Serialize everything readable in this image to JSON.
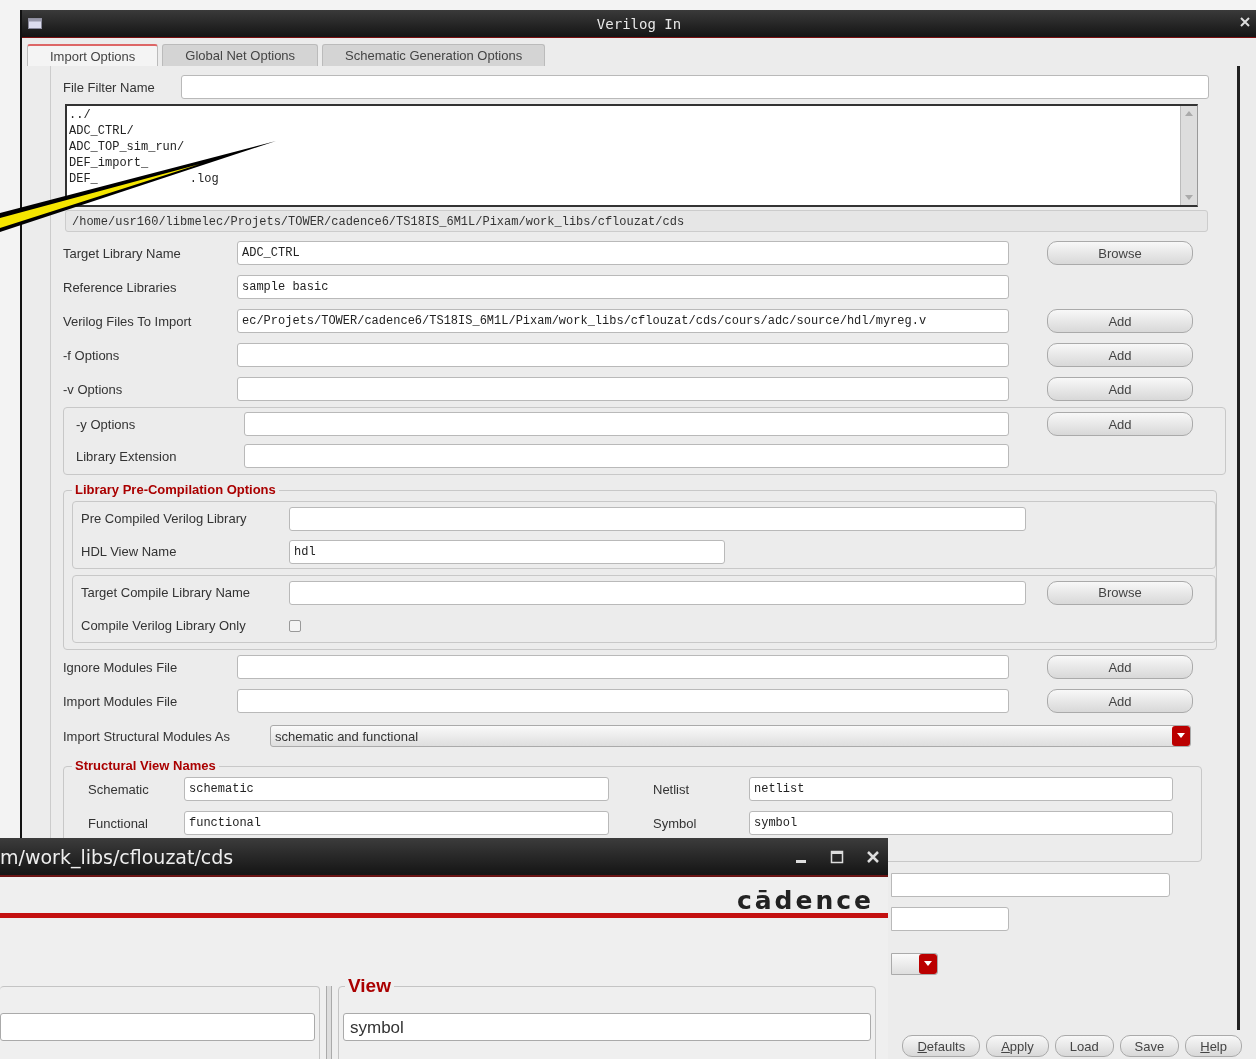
{
  "window": {
    "title": "Verilog In"
  },
  "tabs": [
    {
      "label": "Import Options",
      "selected": true
    },
    {
      "label": "Global Net Options",
      "selected": false
    },
    {
      "label": "Schematic Generation Options",
      "selected": false
    }
  ],
  "file_filter": {
    "label": "File Filter Name"
  },
  "file_list": [
    [
      "../"
    ],
    [
      "ADC_CTRL/"
    ],
    [
      "ADC_TOP_sim_run/"
    ],
    [
      "DEF_import_"
    ],
    [
      "DEF_",
      ".log"
    ]
  ],
  "path": "/home/usr160/libmelec/Projets/TOWER/cadence6/TS18IS_6M1L/Pixam/work_libs/cflouzat/cds",
  "rows": [
    {
      "label": "Target Library Name",
      "value": "ADC_CTRL",
      "button": "Browse"
    },
    {
      "label": "Reference Libraries",
      "value": "sample basic"
    },
    {
      "label": "Verilog Files To Import",
      "value": "ec/Projets/TOWER/cadence6/TS18IS_6M1L/Pixam/work_libs/cflouzat/cds/cours/adc/source/hdl/myreg.v",
      "button": "Add"
    },
    {
      "label": "-f Options",
      "button": "Add"
    },
    {
      "label": "-v Options",
      "button": "Add"
    }
  ],
  "y_group": [
    {
      "label": "-y Options",
      "button": "Add"
    },
    {
      "label": "Library Extension"
    }
  ],
  "precompilation": {
    "title": "Library Pre-Compilation Options",
    "subgroups": [
      [
        {
          "kind": "text",
          "label": "Pre Compiled Verilog Library"
        },
        {
          "kind": "short",
          "label": "HDL View Name",
          "value": "hdl"
        }
      ],
      [
        {
          "kind": "text",
          "label": "Target Compile Library Name",
          "button": "Browse"
        },
        {
          "kind": "checkbox",
          "label": "Compile Verilog Library Only",
          "checked": false
        }
      ]
    ]
  },
  "rows_after": [
    {
      "label": "Ignore Modules File",
      "button": "Add"
    },
    {
      "label": "Import Modules File",
      "button": "Add"
    }
  ],
  "structural_modules": {
    "label": "Import Structural Modules As",
    "value": "schematic and functional"
  },
  "structural_view_names": {
    "title": "Structural View Names",
    "fields": [
      {
        "label": "Schematic",
        "value": "schematic"
      },
      {
        "label": "Netlist",
        "value": "netlist"
      },
      {
        "label": "Functional",
        "value": "functional"
      },
      {
        "label": "Symbol",
        "value": "symbol"
      }
    ]
  },
  "buttons": [
    {
      "label": "Defaults",
      "mnemonic": true
    },
    {
      "label": "Apply",
      "mnemonic": true
    },
    {
      "label": "Load",
      "mnemonic": false
    },
    {
      "label": "Save",
      "mnemonic": false
    },
    {
      "label": "Help",
      "mnemonic": true
    }
  ],
  "cadence_window": {
    "title": "m/work_libs/cflouzat/cds",
    "logo": "cādence",
    "view_group": {
      "title": "View",
      "value": "symbol"
    }
  }
}
